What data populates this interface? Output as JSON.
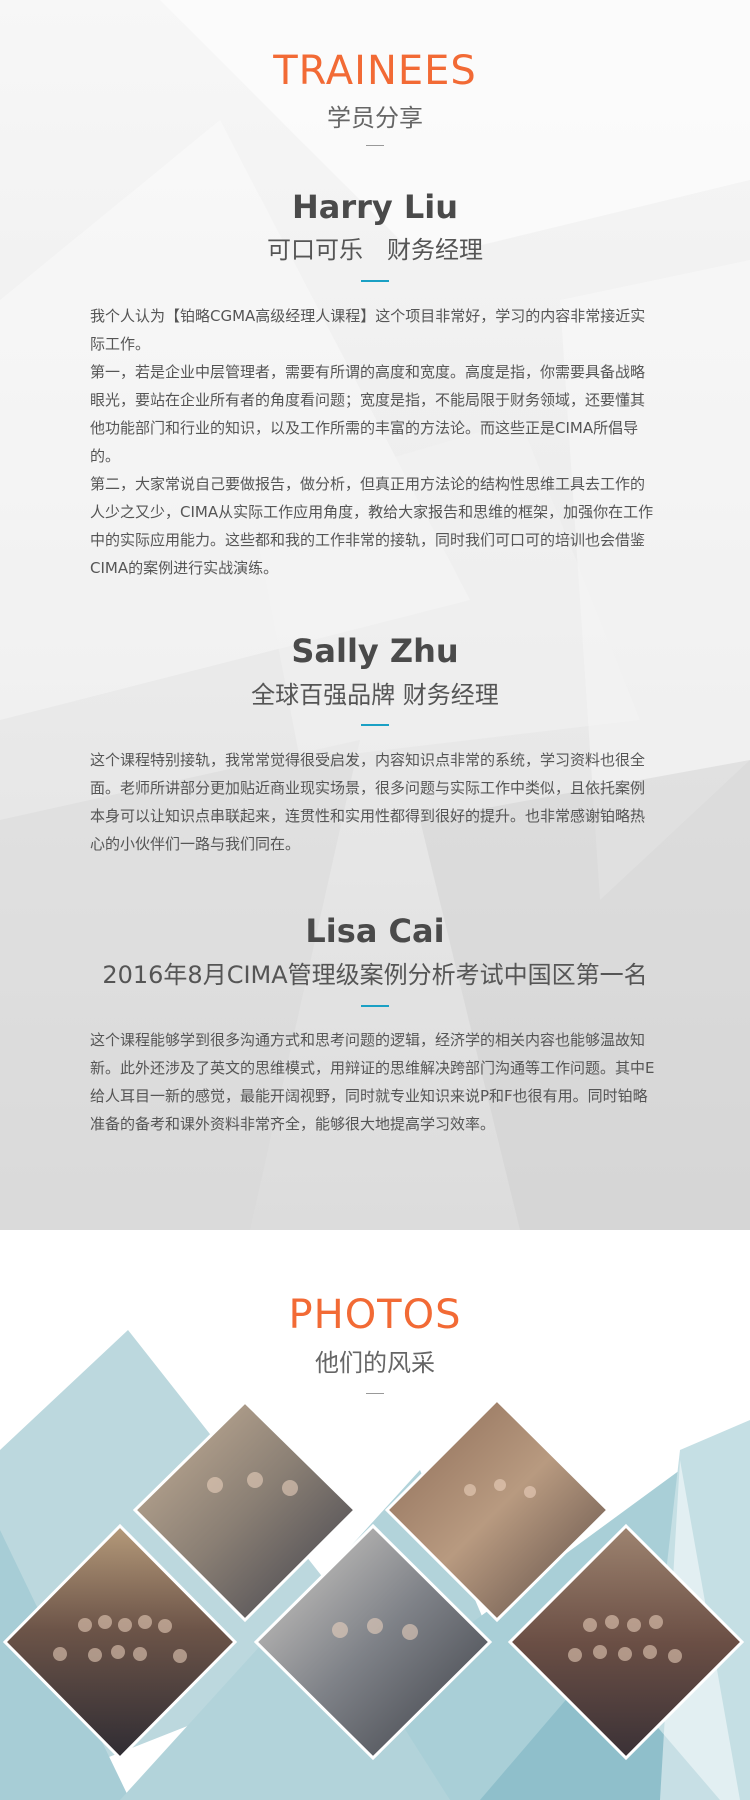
{
  "trainees_section": {
    "title_en": "TRAINEES",
    "title_cn": "学员分享"
  },
  "trainees": [
    {
      "name": "Harry Liu",
      "role": "可口可乐　财务经理",
      "paragraphs": [
        "我个人认为【铂略CGMA高级经理人课程】这个项目非常好，学习的内容非常接近实际工作。",
        "第一，若是企业中层管理者，需要有所谓的高度和宽度。高度是指，你需要具备战略眼光，要站在企业所有者的角度看问题；宽度是指，不能局限于财务领域，还要懂其他功能部门和行业的知识，以及工作所需的丰富的方法论。而这些正是CIMA所倡导的。",
        "第二，大家常说自己要做报告，做分析，但真正用方法论的结构性思维工具去工作的人少之又少，CIMA从实际工作应用角度，教给大家报告和思维的框架，加强你在工作中的实际应用能力。这些都和我的工作非常的接轨，同时我们可口可的培训也会借鉴CIMA的案例进行实战演练。"
      ]
    },
    {
      "name": "Sally Zhu",
      "role": "全球百强品牌 财务经理",
      "paragraphs": [
        "这个课程特别接轨，我常常觉得很受启发，内容知识点非常的系统，学习资料也很全面。老师所讲部分更加贴近商业现实场景，很多问题与实际工作中类似，且依托案例本身可以让知识点串联起来，连贯性和实用性都得到很好的提升。也非常感谢铂略热心的小伙伴们一路与我们同在。"
      ]
    },
    {
      "name": "Lisa Cai",
      "role": "2016年8月CIMA管理级案例分析考试中国区第一名",
      "paragraphs": [
        "这个课程能够学到很多沟通方式和思考问题的逻辑，经济学的相关内容也能够温故知新。此外还涉及了英文的思维模式，用辩证的思维解决跨部门沟通等工作问题。其中E给人耳目一新的感觉，最能开阔视野，同时就专业知识来说P和F也很有用。同时铂略准备的备考和课外资料非常齐全，能够很大地提高学习效率。"
      ]
    }
  ],
  "photos_section": {
    "title_en": "PHOTOS",
    "title_cn": "他们的风采"
  },
  "photos": [
    {
      "subject": "classroom-discussion"
    },
    {
      "subject": "lecture-hall"
    },
    {
      "subject": "group-photo"
    },
    {
      "subject": "students-at-laptops"
    },
    {
      "subject": "large-group-photo"
    }
  ],
  "colors": {
    "accent_orange": "#f26a35",
    "accent_teal": "#1aa0c4",
    "triangle_light": "#bcd8de",
    "triangle_mid": "#a7cdd6",
    "triangle_dark": "#8fbfcb"
  }
}
